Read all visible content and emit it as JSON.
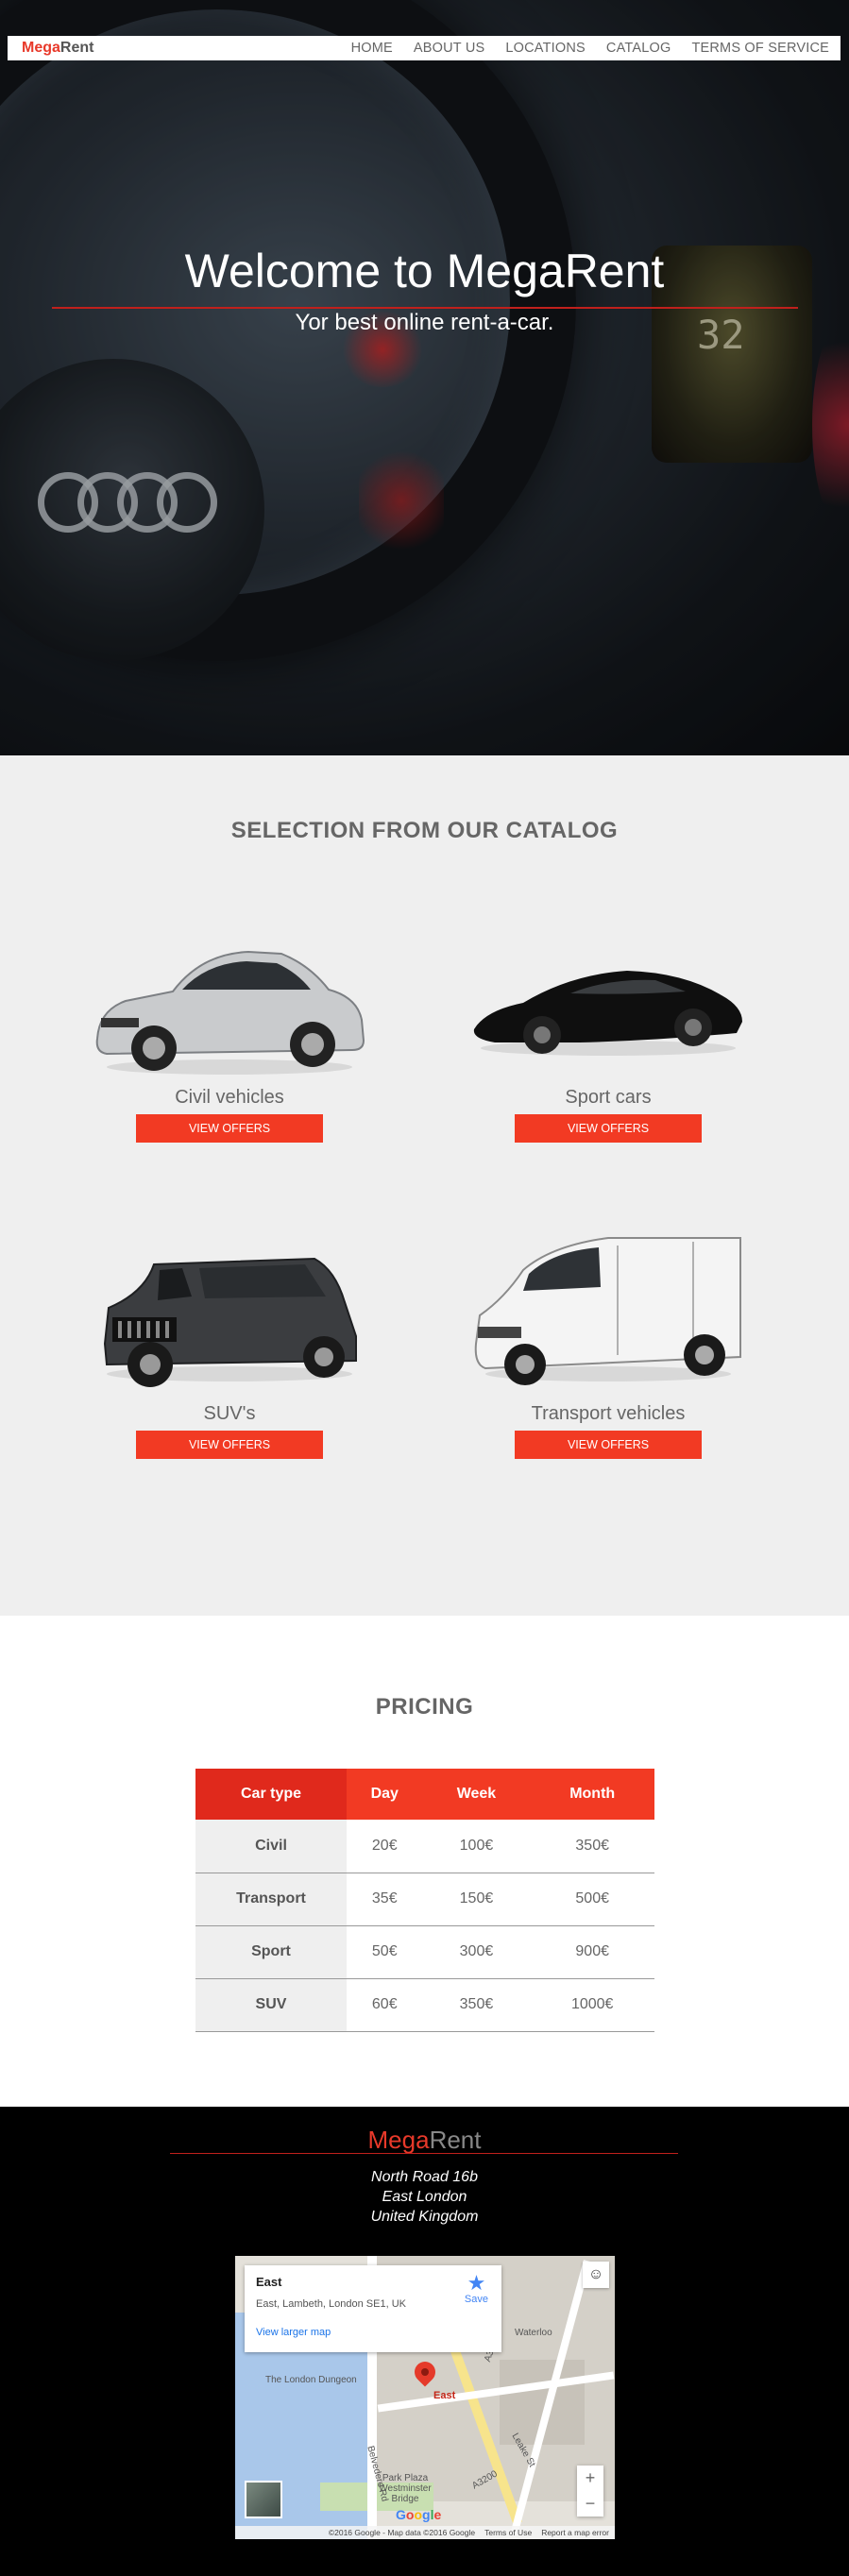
{
  "nav": {
    "brand_a": "Mega",
    "brand_b": "Rent",
    "items": [
      "HOME",
      "ABOUT US",
      "LOCATIONS",
      "CATALOG",
      "TERMS OF SERVICE"
    ]
  },
  "hero": {
    "title": "Welcome to MegaRent",
    "subtitle": "Yor best online rent-a-car.",
    "dash_reading": "32"
  },
  "catalog": {
    "title": "SELECTION FROM OUR CATALOG",
    "items": [
      {
        "name": "Civil vehicles",
        "button": "VIEW OFFERS",
        "icon": "sedan-car-image"
      },
      {
        "name": "Sport cars",
        "button": "VIEW OFFERS",
        "icon": "sports-car-image"
      },
      {
        "name": "SUV's",
        "button": "VIEW OFFERS",
        "icon": "suv-car-image"
      },
      {
        "name": "Transport vehicles",
        "button": "VIEW OFFERS",
        "icon": "van-image"
      }
    ]
  },
  "pricing": {
    "title": "PRICING",
    "headers": [
      "Car type",
      "Day",
      "Week",
      "Month"
    ],
    "rows": [
      [
        "Civil",
        "20€",
        "100€",
        "350€"
      ],
      [
        "Transport",
        "35€",
        "150€",
        "500€"
      ],
      [
        "Sport",
        "50€",
        "300€",
        "900€"
      ],
      [
        "SUV",
        "60€",
        "350€",
        "1000€"
      ]
    ]
  },
  "footer": {
    "brand_a": "Mega",
    "brand_b": "Rent",
    "address": [
      "North Road 16b",
      "East London",
      "United Kingdom"
    ],
    "map": {
      "place_title": "East",
      "place_address": "East, Lambeth, London SE1, UK",
      "larger_map": "View larger map",
      "save": "Save",
      "pin_label": "East",
      "labels": [
        "Waterloo",
        "The London Dungeon",
        "Belvedere Rd",
        "A3200",
        "Leake St",
        "Park Plaza Westminster Bridge",
        "A3200"
      ],
      "attribution": [
        "©2016 Google - Map data ©2016 Google",
        "Terms of Use",
        "Report a map error"
      ],
      "zoom_in": "+",
      "zoom_out": "−",
      "google": [
        "G",
        "o",
        "o",
        "g",
        "l",
        "e"
      ]
    }
  },
  "colors": {
    "accent": "#f23a23",
    "accent_dark": "#e0291c",
    "brand_red": "#e8392a"
  }
}
